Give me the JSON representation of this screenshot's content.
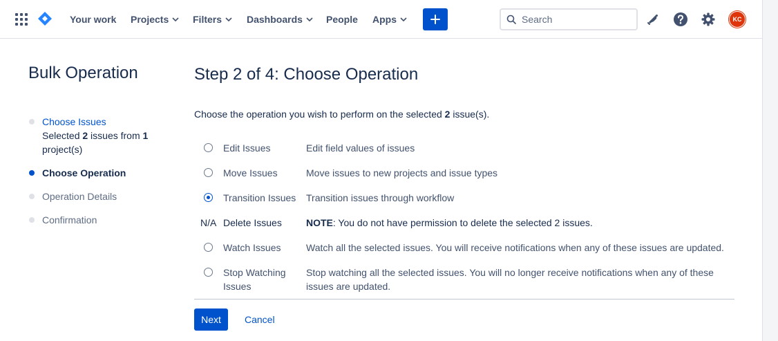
{
  "nav": {
    "items": [
      {
        "label": "Your work",
        "dropdown": false
      },
      {
        "label": "Projects",
        "dropdown": true
      },
      {
        "label": "Filters",
        "dropdown": true
      },
      {
        "label": "Dashboards",
        "dropdown": true
      },
      {
        "label": "People",
        "dropdown": false
      },
      {
        "label": "Apps",
        "dropdown": true
      }
    ],
    "search_placeholder": "Search",
    "avatar_initials": "KC",
    "colors": {
      "brand": "#0052cc",
      "avatar": "#de350b"
    },
    "icons": [
      "app-switcher-icon",
      "jira-logo-icon",
      "plus-icon",
      "search-icon",
      "notification-icon",
      "help-icon",
      "settings-icon"
    ]
  },
  "sidebar": {
    "title": "Bulk Operation",
    "steps": [
      {
        "label": "Choose Issues",
        "state": "done",
        "sub_parts": [
          "Selected ",
          "2",
          " issues from ",
          "1",
          " project(s)"
        ]
      },
      {
        "label": "Choose Operation",
        "state": "active"
      },
      {
        "label": "Operation Details",
        "state": "pending"
      },
      {
        "label": "Confirmation",
        "state": "pending"
      }
    ]
  },
  "main": {
    "title": "Step 2 of 4: Choose Operation",
    "intro_before": "Choose the operation you wish to perform on the selected ",
    "intro_count": "2",
    "intro_after": " issue(s).",
    "operations": [
      {
        "name": "Edit Issues",
        "desc": "Edit field values of issues",
        "selectable": true,
        "checked": false
      },
      {
        "name": "Move Issues",
        "desc": "Move issues to new projects and issue types",
        "selectable": true,
        "checked": false
      },
      {
        "name": "Transition Issues",
        "desc": "Transition issues through workflow",
        "selectable": true,
        "checked": true
      },
      {
        "name": "Delete Issues",
        "na_label": "N/A",
        "note_label": "NOTE",
        "desc": ": You do not have permission to delete the selected 2 issues.",
        "selectable": false,
        "checked": false
      },
      {
        "name": "Watch Issues",
        "desc": "Watch all the selected issues. You will receive notifications when any of these issues are updated.",
        "selectable": true,
        "checked": false
      },
      {
        "name": "Stop Watching Issues",
        "desc": "Stop watching all the selected issues. You will no longer receive notifications when any of these issues are updated.",
        "selectable": true,
        "checked": false
      }
    ],
    "next_label": "Next",
    "cancel_label": "Cancel"
  }
}
